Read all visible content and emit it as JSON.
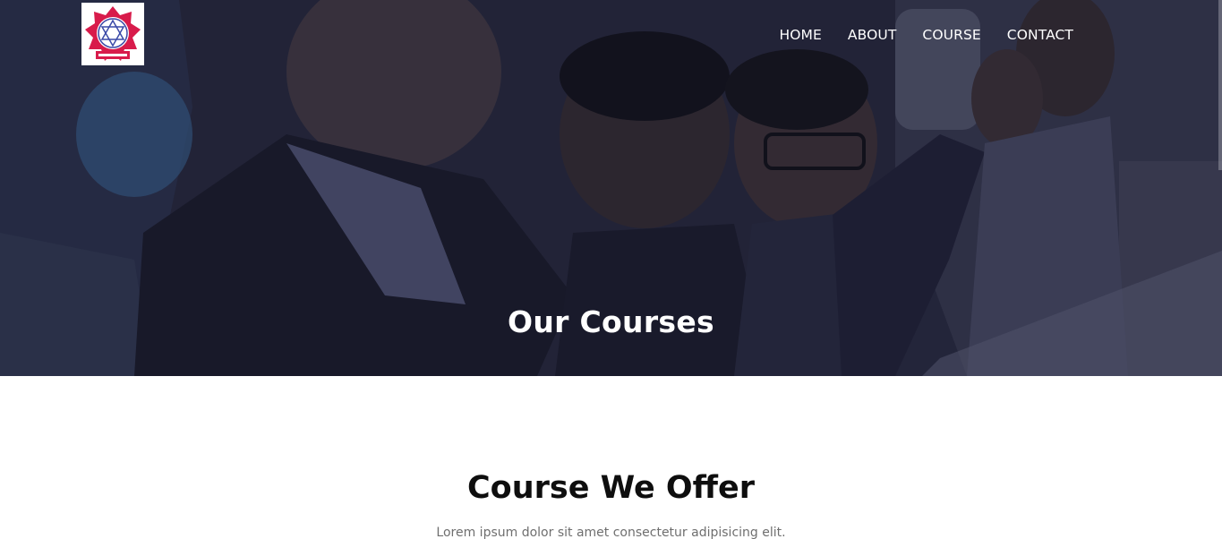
{
  "header": {
    "logo_icon": "school-emblem-icon",
    "nav": {
      "home": "HOME",
      "about": "ABOUT",
      "course": "COURSE",
      "contact": "CONTACT"
    }
  },
  "hero": {
    "title": "Our Courses"
  },
  "main": {
    "section_title": "Course We Offer",
    "section_subtitle": "Lorem ipsum dolor sit amet consectetur adipisicing elit."
  },
  "colors": {
    "hero_overlay": "#1f2033",
    "logo_red": "#d81b4b",
    "logo_blue": "#3b4aa8",
    "heading": "#0e0e0e",
    "body_text": "#6f6f6f"
  }
}
